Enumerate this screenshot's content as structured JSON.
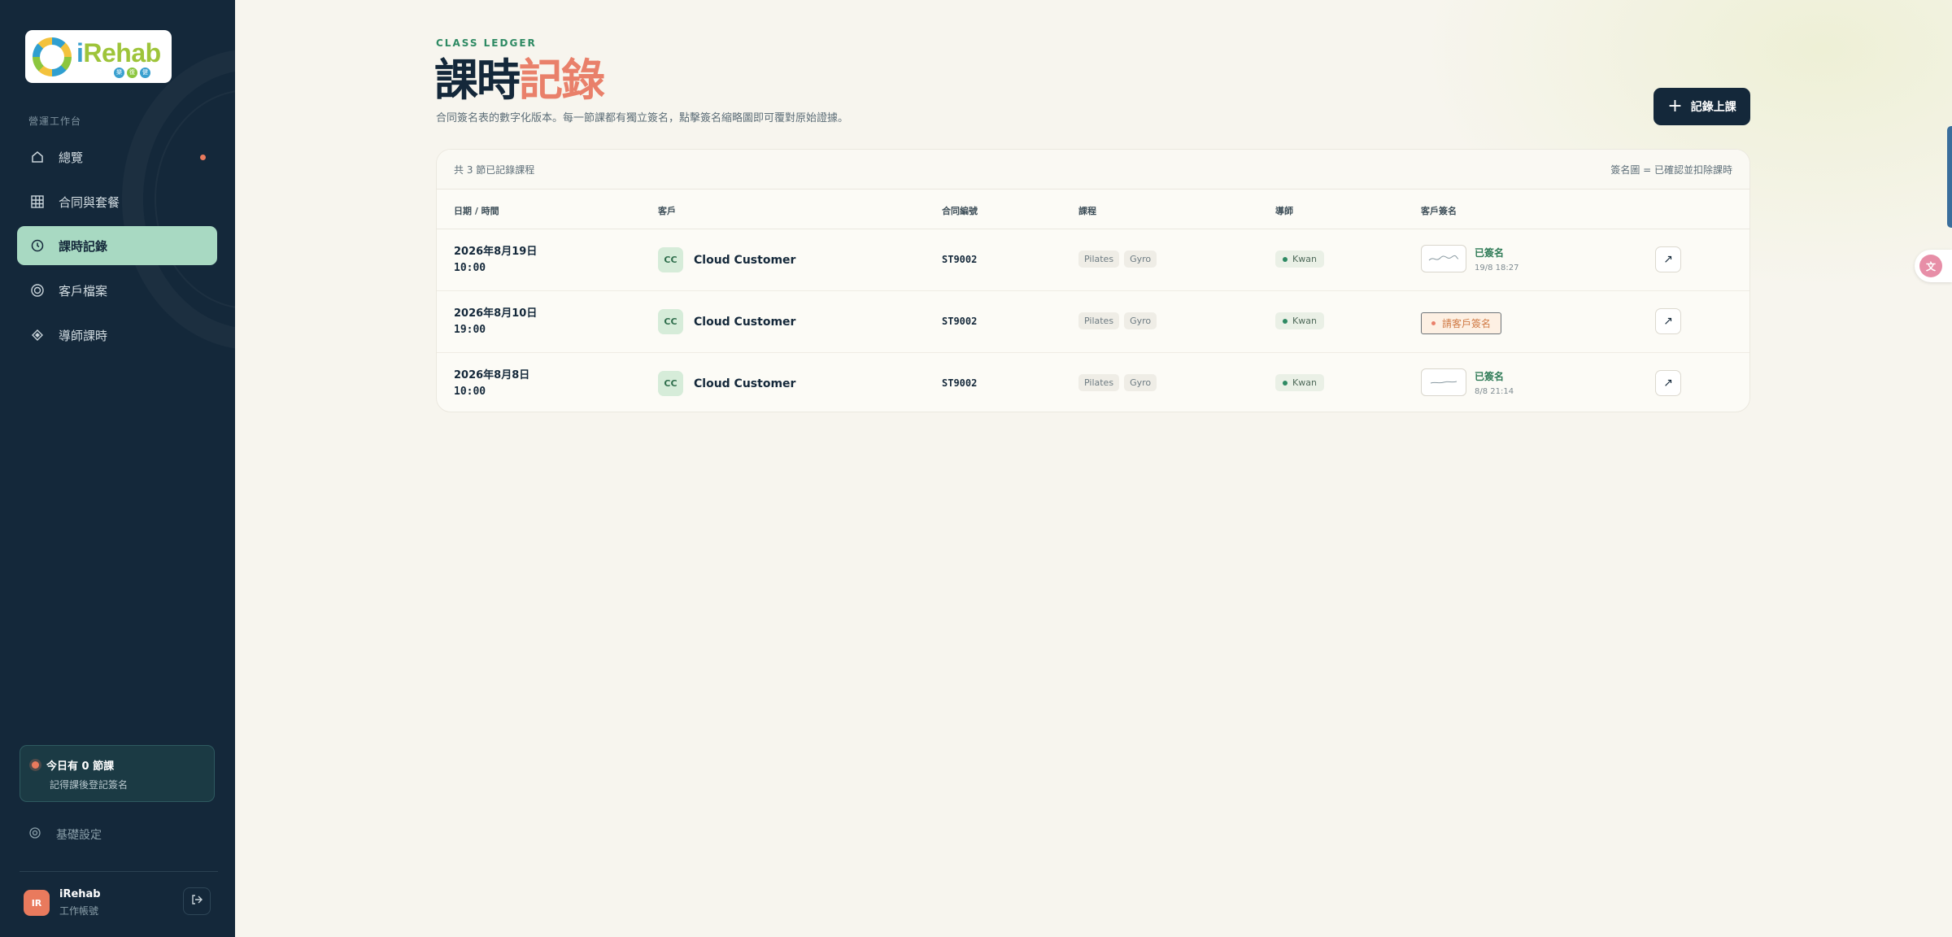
{
  "brand": {
    "logo_word_i": "i",
    "logo_word_rest": "Rehab",
    "logo_sub": [
      "樂",
      "復",
      "健"
    ]
  },
  "sidebar": {
    "section_label": "營運工作台",
    "items": [
      {
        "label": "總覽",
        "icon": "home-icon",
        "has_dot": true
      },
      {
        "label": "合同與套餐",
        "icon": "grid-icon"
      },
      {
        "label": "課時記錄",
        "icon": "clock-icon",
        "active": true
      },
      {
        "label": "客戶檔案",
        "icon": "target-icon"
      },
      {
        "label": "導師課時",
        "icon": "diamond-icon"
      }
    ],
    "today_card": {
      "title": "今日有 0 節課",
      "subtitle": "記得課後登記簽名"
    },
    "settings_label": "基礎設定",
    "user": {
      "initials": "IR",
      "name": "iRehab",
      "role": "工作帳號"
    }
  },
  "header": {
    "eyebrow": "CLASS LEDGER",
    "title_part1": "課時",
    "title_part2": "記錄",
    "subtitle": "合同簽名表的數字化版本。每一節課都有獨立簽名，點擊簽名縮略圖即可覆對原始證據。",
    "record_button": "記錄上課"
  },
  "table": {
    "count_text": "共 3 節已記錄課程",
    "legend_text": "簽名圖 = 已確認並扣除課時",
    "columns": [
      "日期 / 時間",
      "客戶",
      "合同編號",
      "課程",
      "導師",
      "客戶簽名"
    ],
    "rows": [
      {
        "date": "2026年8月19日",
        "time": "10:00",
        "client_initials": "CC",
        "client": "Cloud Customer",
        "contract": "ST9002",
        "courses": [
          "Pilates",
          "Gyro"
        ],
        "coach": "Kwan",
        "signed": true,
        "sign_status": "已簽名",
        "sign_time": "19/8 18:27"
      },
      {
        "date": "2026年8月10日",
        "time": "19:00",
        "client_initials": "CC",
        "client": "Cloud Customer",
        "contract": "ST9002",
        "courses": [
          "Pilates",
          "Gyro"
        ],
        "coach": "Kwan",
        "signed": false,
        "pending_label": "請客戶簽名"
      },
      {
        "date": "2026年8月8日",
        "time": "10:00",
        "client_initials": "CC",
        "client": "Cloud Customer",
        "contract": "ST9002",
        "courses": [
          "Pilates",
          "Gyro"
        ],
        "coach": "Kwan",
        "signed": true,
        "sign_status": "已簽名",
        "sign_time": "8/8 21:14"
      }
    ]
  },
  "colors": {
    "sidebar": "#14283a",
    "accent_green": "#a8d9c2",
    "accent_coral": "#e9806a"
  }
}
